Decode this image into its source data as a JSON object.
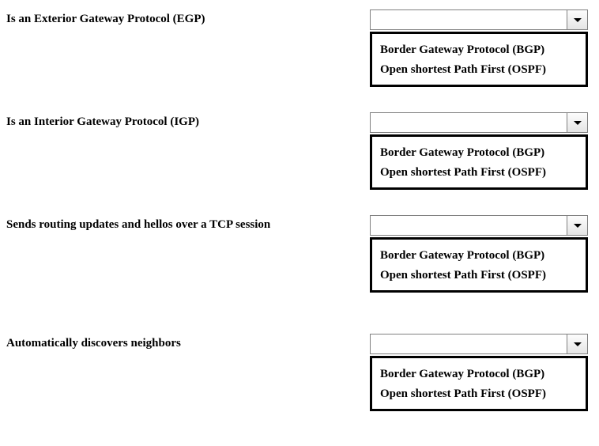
{
  "questions": [
    {
      "prompt": "Is an Exterior Gateway Protocol (EGP)",
      "options": [
        "Border Gateway Protocol (BGP)",
        "Open shortest Path First (OSPF)"
      ]
    },
    {
      "prompt": "Is an Interior Gateway Protocol (IGP)",
      "options": [
        "Border Gateway Protocol (BGP)",
        "Open shortest Path First (OSPF)"
      ]
    },
    {
      "prompt": "Sends routing updates and hellos over a TCP session",
      "options": [
        "Border Gateway Protocol (BGP)",
        "Open shortest Path First (OSPF)"
      ]
    },
    {
      "prompt": "Automatically discovers neighbors",
      "options": [
        "Border Gateway Protocol (BGP)",
        "Open shortest Path First (OSPF)"
      ]
    }
  ]
}
